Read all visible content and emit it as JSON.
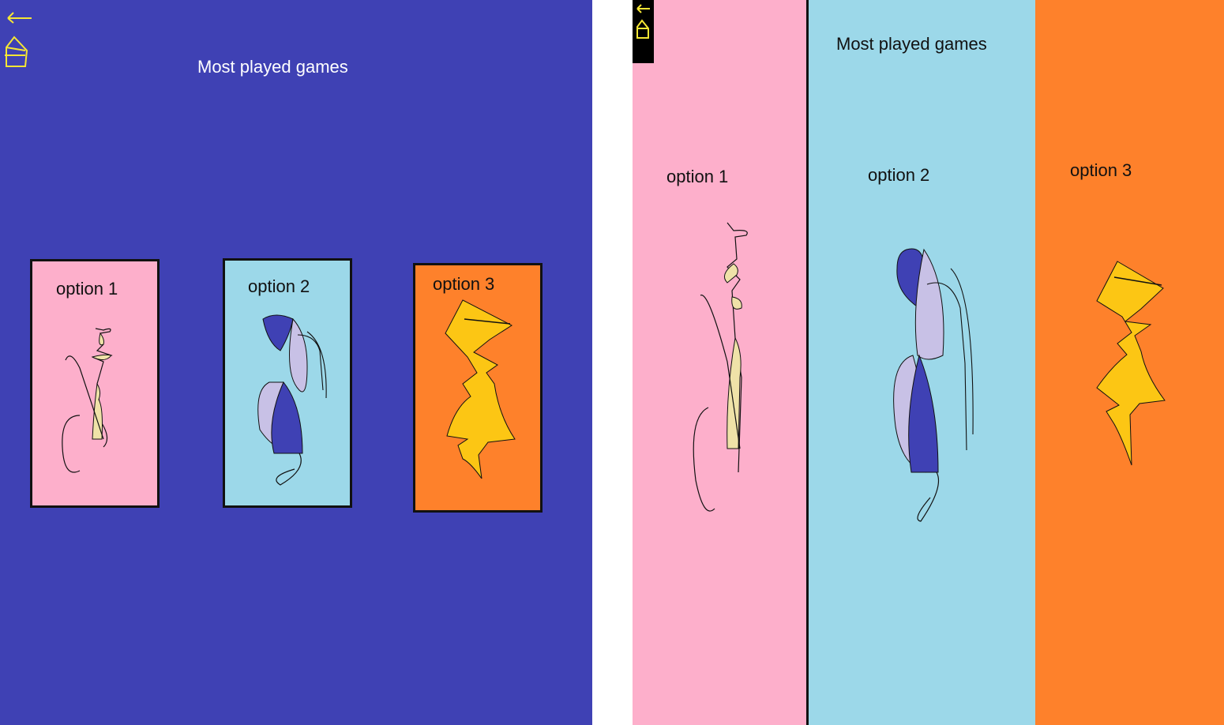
{
  "left_screen": {
    "background": "#3f41b4",
    "title": "Most played games",
    "nav": {
      "back_icon": "arrow-left-icon",
      "home_icon": "home-icon",
      "icon_color": "#f5e634"
    },
    "options": [
      {
        "label": "option 1",
        "color": "#fdafcb",
        "art": "scribble-art"
      },
      {
        "label": "option 2",
        "color": "#9cd8e9",
        "art": "abstract-art"
      },
      {
        "label": "option 3",
        "color": "#fe812b",
        "art": "flame-art"
      }
    ]
  },
  "right_screen": {
    "title": "Most played games",
    "nav": {
      "back_icon": "arrow-left-icon",
      "home_icon": "home-icon",
      "bar_color": "#000000",
      "icon_color": "#f5e634"
    },
    "options": [
      {
        "label": "option 1",
        "color": "#fdafcb",
        "art": "scribble-art"
      },
      {
        "label": "option 2",
        "color": "#9cd8e9",
        "art": "abstract-art"
      },
      {
        "label": "option 3",
        "color": "#fe812b",
        "art": "flame-art"
      }
    ]
  }
}
